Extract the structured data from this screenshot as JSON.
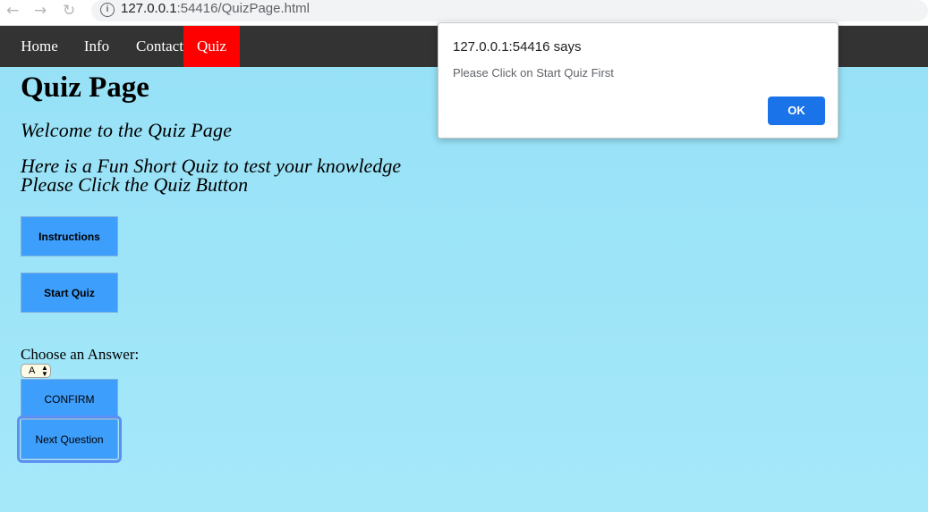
{
  "browser": {
    "back_icon": "←",
    "forward_icon": "→",
    "reload_icon": "↻",
    "info_icon": "i",
    "url_host": "127.0.0.1",
    "url_rest": ":54416/QuizPage.html"
  },
  "nav": {
    "items": [
      {
        "label": "Home"
      },
      {
        "label": "Info"
      },
      {
        "label": "Contact"
      },
      {
        "label": "Quiz"
      }
    ],
    "active": "Quiz",
    "bar_color": "#333333",
    "active_color": "#ff0000"
  },
  "page": {
    "title": "Quiz Page",
    "welcome": "Welcome to the Quiz Page",
    "desc_line1": "Here is a Fun Short Quiz to test your knowledge",
    "desc_line2": "Please Click the Quiz Button",
    "instructions_label": "Instructions",
    "start_label": "Start Quiz",
    "choose_label": "Choose an Answer:",
    "answer_value": "A",
    "confirm_label": "CONFIRM",
    "next_label": "Next Question",
    "button_color": "#3d9efc"
  },
  "dialog": {
    "title": "127.0.0.1:54416 says",
    "message": "Please Click on Start Quiz First",
    "ok_label": "OK",
    "ok_color": "#1a73e8"
  }
}
